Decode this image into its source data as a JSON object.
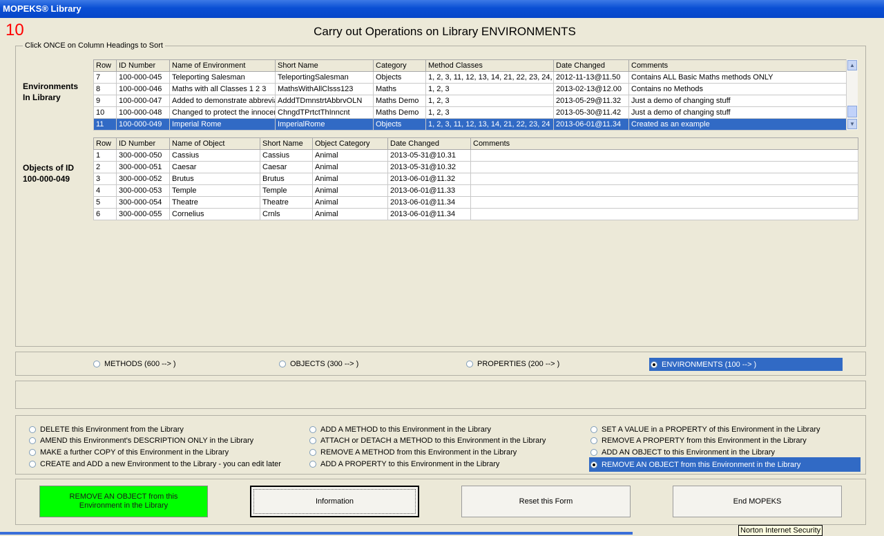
{
  "window": {
    "title": "MOPEKS® Library"
  },
  "form_number": "10",
  "page_title": "Carry out Operations on Library ENVIRONMENTS",
  "sort_hint": "Click ONCE on Column Headings to Sort",
  "environments_label": [
    "Environments",
    "In Library"
  ],
  "env_table": {
    "columns": [
      "Row",
      "ID Number",
      "Name of Environment",
      "Short Name",
      "Category",
      "Method Classes",
      "Date Changed",
      "Comments"
    ],
    "rows": [
      [
        "7",
        "100-000-045",
        "Teleporting Salesman",
        "TeleportingSalesman",
        "Objects",
        "1, 2, 3, 11, 12, 13, 14, 21, 22, 23, 24,",
        "2012-11-13@11.50",
        "Contains ALL Basic Maths methods ONLY"
      ],
      [
        "8",
        "100-000-046",
        "Maths with all Classes 1 2 3",
        "MathsWithAllClsss123",
        "Maths",
        "1, 2, 3",
        "2013-02-13@12.00",
        "Contains no Methods"
      ],
      [
        "9",
        "100-000-047",
        "Added to demonstrate abbrevia",
        "AdddTDmnstrtAbbrvOLN",
        "Maths Demo",
        "1, 2, 3",
        "2013-05-29@11.32",
        "Just a demo of changing stuff"
      ],
      [
        "10",
        "100-000-048",
        "Changed to protect the innocen",
        "ChngdTPrtctThInncnt",
        "Maths Demo",
        "1, 2, 3",
        "2013-05-30@11.42",
        "Just a demo of changing stuff"
      ],
      [
        "11",
        "100-000-049",
        "Imperial Rome",
        "ImperialRome",
        "Objects",
        "1, 2, 3, 11, 12, 13, 14, 21, 22, 23, 24",
        "2013-06-01@11.34",
        "Created as an example"
      ]
    ],
    "selected_row": 4
  },
  "objects_label": [
    "Objects of ID",
    "100-000-049"
  ],
  "obj_table": {
    "columns": [
      "Row",
      "ID Number",
      "Name of Object",
      "Short Name",
      "Object Category",
      "Date Changed",
      "Comments"
    ],
    "rows": [
      [
        "1",
        "300-000-050",
        "Cassius",
        "Cassius",
        "Animal",
        "2013-05-31@10.31",
        ""
      ],
      [
        "2",
        "300-000-051",
        "Caesar",
        "Caesar",
        "Animal",
        "2013-05-31@10.32",
        ""
      ],
      [
        "3",
        "300-000-052",
        "Brutus",
        "Brutus",
        "Animal",
        "2013-06-01@11.32",
        ""
      ],
      [
        "4",
        "300-000-053",
        "Temple",
        "Temple",
        "Animal",
        "2013-06-01@11.33",
        ""
      ],
      [
        "5",
        "300-000-054",
        "Theatre",
        "Theatre",
        "Animal",
        "2013-06-01@11.34",
        ""
      ],
      [
        "6",
        "300-000-055",
        "Cornelius",
        "Crnls",
        "Animal",
        "2013-06-01@11.34",
        ""
      ]
    ]
  },
  "library_types": [
    {
      "label": "METHODS (600 --> )",
      "selected": false
    },
    {
      "label": "OBJECTS (300 --> )",
      "selected": false
    },
    {
      "label": "PROPERTIES (200 --> )",
      "selected": false
    },
    {
      "label": "ENVIRONMENTS (100 --> )",
      "selected": true
    }
  ],
  "operations": [
    [
      "DELETE this Environment from the Library",
      "AMEND this Environment's DESCRIPTION ONLY in the Library",
      "MAKE a further COPY of this Environment in the Library",
      "CREATE and ADD a new Environment to the Library - you can edit later"
    ],
    [
      "ADD A METHOD to this Environment in the Library",
      "ATTACH or DETACH a METHOD to this Environment in the Library",
      "REMOVE A METHOD from this Environment in the Library",
      "ADD A PROPERTY to this Environment in the Library"
    ],
    [
      "SET A VALUE in a PROPERTY of this Environment in the Library",
      "REMOVE A PROPERTY from this Environment in the Library",
      "ADD AN OBJECT to this Environment in the Library",
      "REMOVE  AN OBJECT from this Environment in the Library"
    ]
  ],
  "selected_operation": "REMOVE  AN OBJECT from this Environment in the Library",
  "buttons": {
    "action": [
      "REMOVE AN OBJECT from this",
      "Environment in the Library"
    ],
    "information": "Information",
    "reset": "Reset this Form",
    "end": "End MOPEKS"
  },
  "tooltip": "Norton Internet Security",
  "colors": {
    "selection": "#316ac5",
    "action_button": "#00ff00",
    "form_number": "#ff0000"
  }
}
